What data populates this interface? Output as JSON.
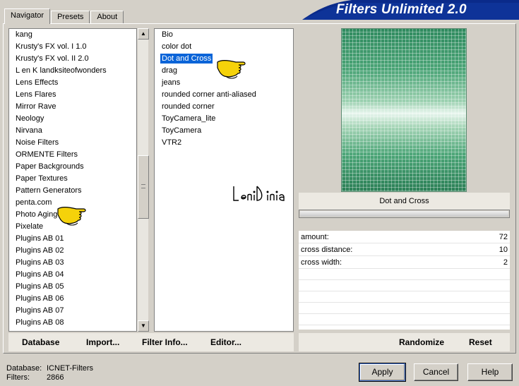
{
  "app": {
    "title": "Filters Unlimited 2.0",
    "accent_color": "#0a2a8a",
    "selection_color": "#0a64d8"
  },
  "tabs": [
    {
      "label": "Navigator",
      "active": true
    },
    {
      "label": "Presets",
      "active": false
    },
    {
      "label": "About",
      "active": false
    }
  ],
  "categories": [
    "kang",
    "Krusty's FX vol. I 1.0",
    "Krusty's FX vol. II 2.0",
    "L en K landksiteofwonders",
    "Lens Effects",
    "Lens Flares",
    "Mirror Rave",
    "Neology",
    "Nirvana",
    "Noise Filters",
    "ORMENTE Filters",
    "Paper Backgrounds",
    "Paper Textures",
    "Pattern Generators",
    "penta.com",
    "Photo Aging Kit",
    "Pixelate",
    "Plugins AB 01",
    "Plugins AB 02",
    "Plugins AB 03",
    "Plugins AB 04",
    "Plugins AB 05",
    "Plugins AB 06",
    "Plugins AB 07",
    "Plugins AB 08"
  ],
  "filters": [
    {
      "label": "Bio",
      "selected": false
    },
    {
      "label": "color dot",
      "selected": false
    },
    {
      "label": "Dot and Cross",
      "selected": true
    },
    {
      "label": "drag",
      "selected": false
    },
    {
      "label": "jeans",
      "selected": false
    },
    {
      "label": "rounded corner anti-aliased",
      "selected": false
    },
    {
      "label": "rounded corner",
      "selected": false
    },
    {
      "label": "ToyCamera_lite",
      "selected": false
    },
    {
      "label": "ToyCamera",
      "selected": false
    },
    {
      "label": "VTR2",
      "selected": false
    }
  ],
  "preview": {
    "filter_name": "Dot and Cross"
  },
  "params": [
    {
      "label": "amount:",
      "value": "72"
    },
    {
      "label": "cross distance:",
      "value": "10"
    },
    {
      "label": "cross width:",
      "value": "2"
    }
  ],
  "toolbar": {
    "database": "Database",
    "import": "Import...",
    "filter_info": "Filter Info...",
    "editor": "Editor...",
    "randomize": "Randomize",
    "reset": "Reset"
  },
  "footer": {
    "database_label": "Database:",
    "database_value": "ICNET-Filters",
    "filters_label": "Filters:",
    "filters_value": "2866",
    "apply": "Apply",
    "cancel": "Cancel",
    "help": "Help"
  },
  "icons": {
    "pointer": "pointing-hand-icon",
    "scroll_up": "arrow-up-icon",
    "scroll_down": "arrow-down-icon"
  }
}
